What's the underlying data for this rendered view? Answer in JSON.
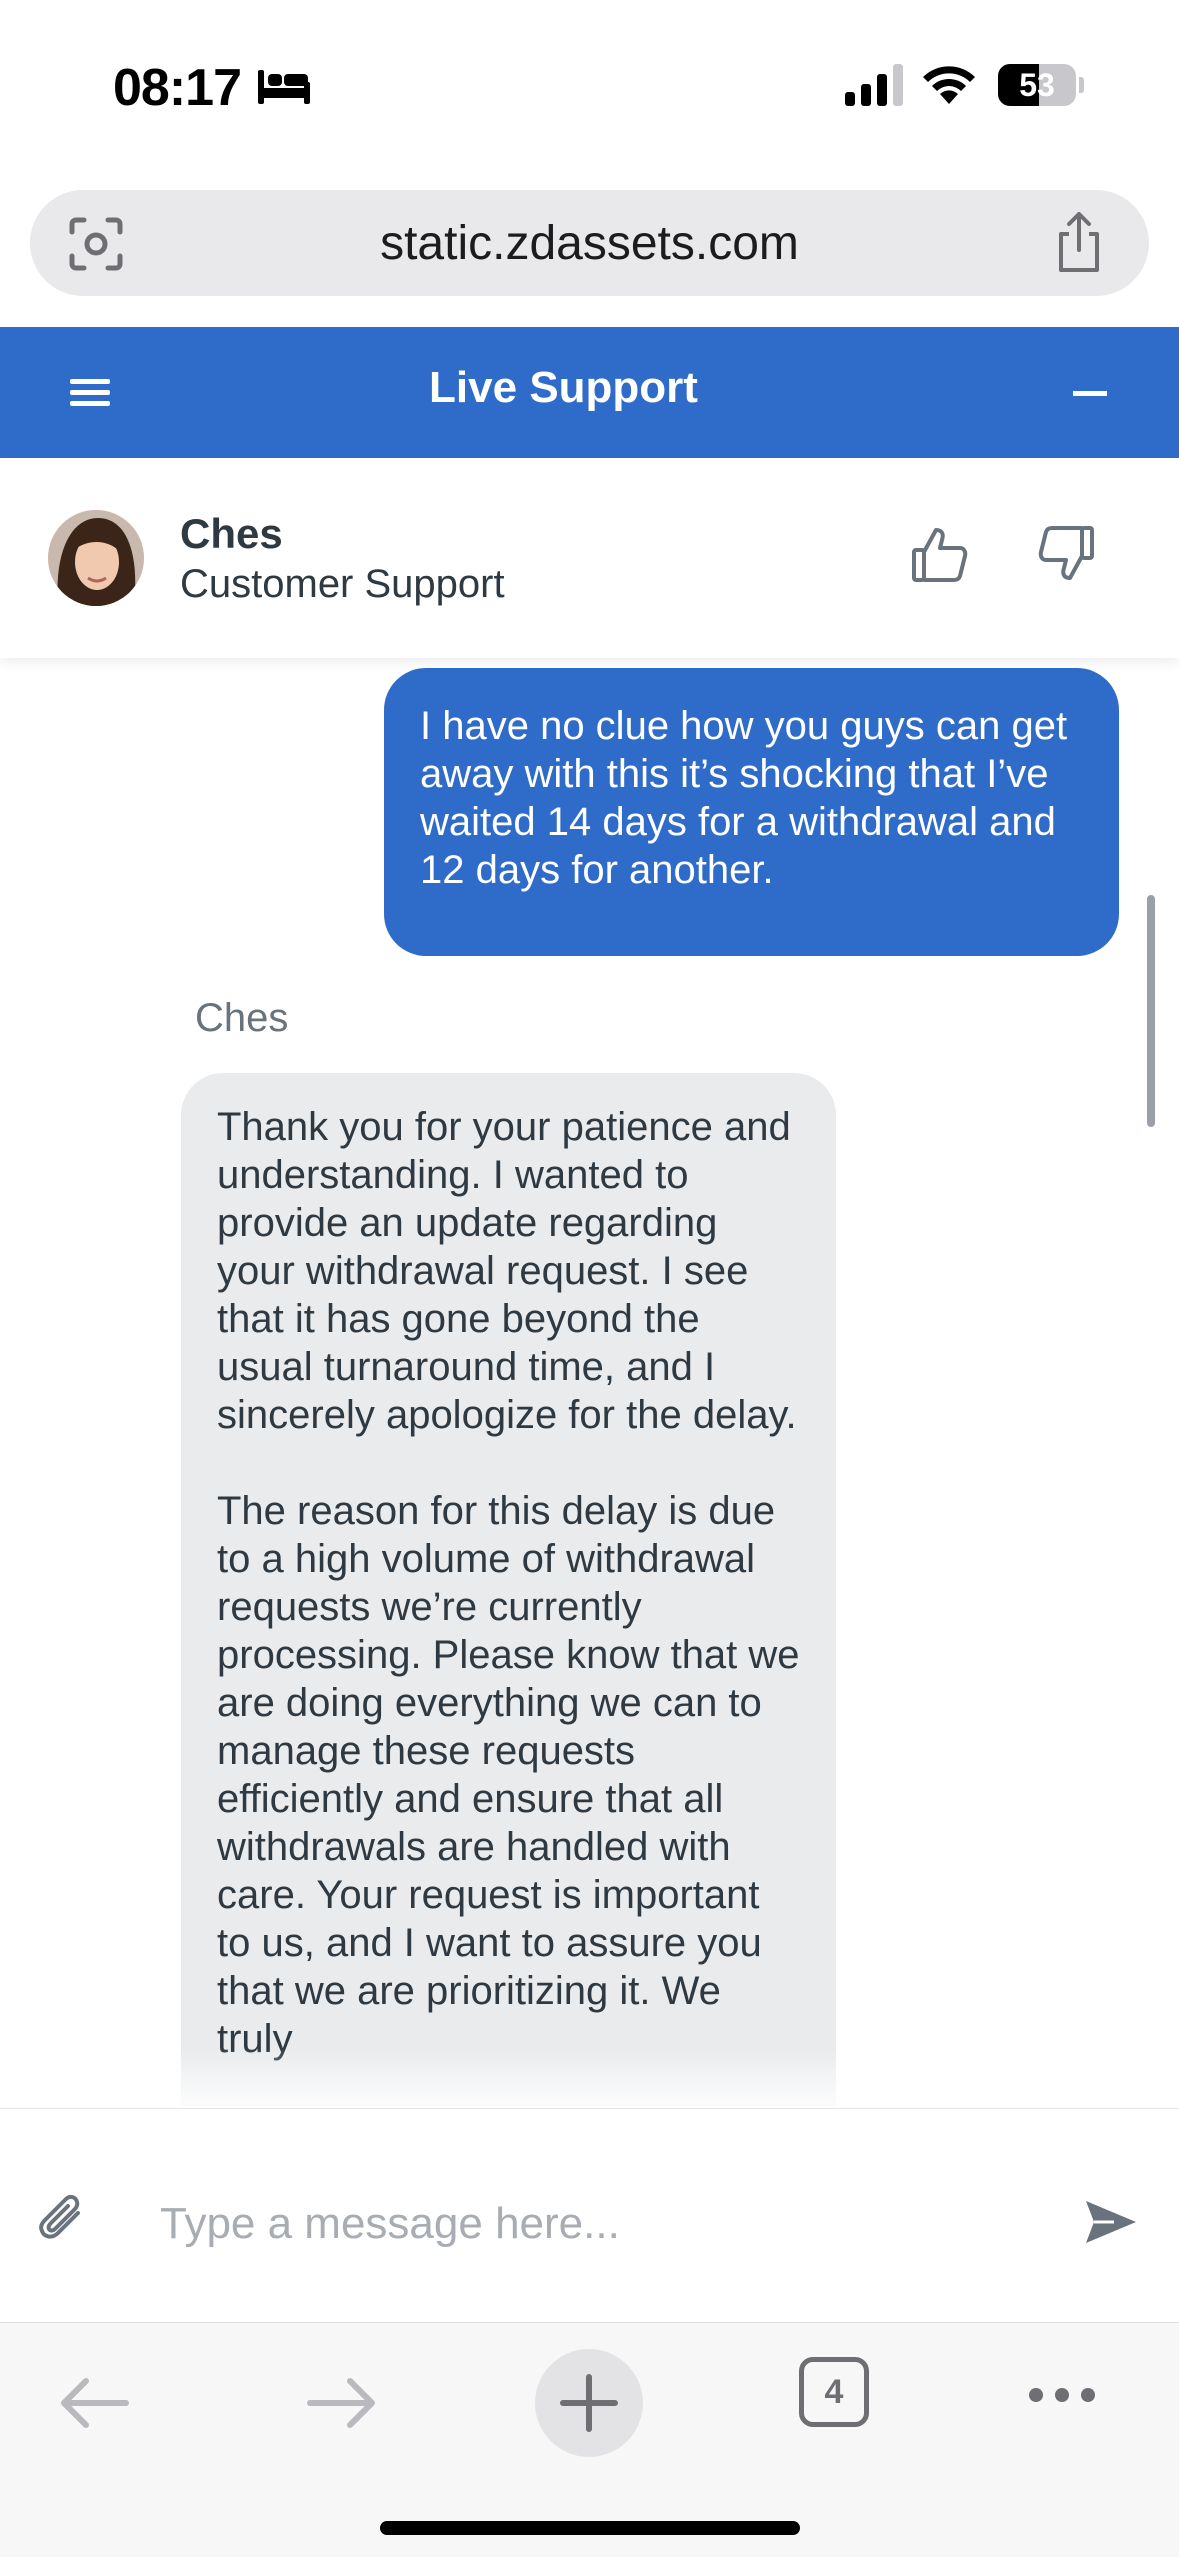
{
  "status_bar": {
    "time": "08:17",
    "battery_percent": "53",
    "battery_level": 0.53,
    "icons": [
      "bed-icon",
      "cellular-signal-icon",
      "wifi-icon",
      "battery-icon"
    ]
  },
  "browser": {
    "url": "static.zdassets.com",
    "icons": [
      "visual-lookup-icon",
      "share-icon"
    ],
    "toolbar": {
      "tab_count": "4",
      "icons": [
        "back-arrow-icon",
        "forward-arrow-icon",
        "plus-icon",
        "more-icon"
      ]
    }
  },
  "header": {
    "title": "Live Support",
    "icons": [
      "hamburger-menu-icon",
      "minimize-icon"
    ]
  },
  "agent": {
    "name": "Ches",
    "role": "Customer Support",
    "icons": [
      "thumbs-up-icon",
      "thumbs-down-icon"
    ]
  },
  "messages": [
    {
      "from": "user",
      "text": "I have no clue how you guys can get away with this it’s shocking that I’ve waited 14 days for a withdrawal and 12 days for another."
    },
    {
      "from": "agent",
      "sender": "Ches",
      "text": "Thank you for your patience and understanding. I wanted to provide an update regarding your withdrawal request. I see that it has gone beyond the usual turnaround time, and I sincerely apologize for the delay.\n\nThe reason for this delay is due to a high volume of withdrawal requests we’re currently processing. Please know that we are doing everything we can to manage these requests efficiently and ensure that all withdrawals are handled with care. Your request is important to us, and I want to assure you that we are prioritizing it. We truly"
    }
  ],
  "composer": {
    "placeholder": "Type a message here...",
    "icons": [
      "paperclip-icon",
      "send-icon"
    ]
  },
  "colors": {
    "brand": "#2f6bc8",
    "agent_bubble": "#e9ebed",
    "text": "#2f3941"
  }
}
